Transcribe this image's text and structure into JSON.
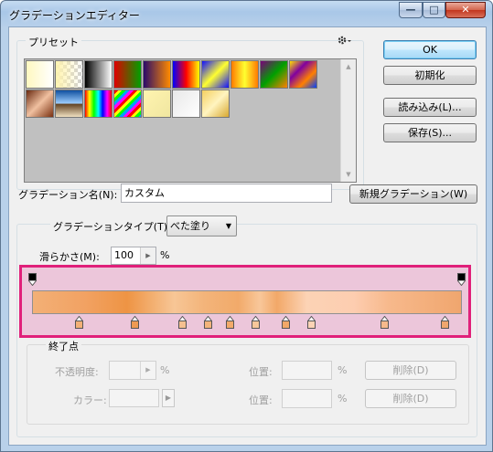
{
  "window": {
    "title": "グラデーションエディター"
  },
  "controls": {
    "minimize": "—",
    "maximize": "□",
    "close": "✕"
  },
  "presets": {
    "label": "プリセット",
    "menu_icon": "gear-icon",
    "swatches": [
      {
        "name": "foreground-to-background",
        "css": "linear-gradient(90deg,#fff8c0,#ffffff)"
      },
      {
        "name": "foreground-to-transparent",
        "css": "linear-gradient(90deg,#fff3b0,rgba(255,255,255,0))"
      },
      {
        "name": "black-white",
        "css": "linear-gradient(90deg,#000,#fff)"
      },
      {
        "name": "red-green",
        "css": "linear-gradient(90deg,#e00000,#00a000)"
      },
      {
        "name": "violet-orange",
        "css": "linear-gradient(90deg,#2a0a6a,#ff8a00)"
      },
      {
        "name": "blue-red-yellow",
        "css": "linear-gradient(90deg,#0000ff,#ff0000,#ffff00)"
      },
      {
        "name": "blue-yellow-blue",
        "css": "linear-gradient(135deg,#1010ff,#ffff30,#1010ff)"
      },
      {
        "name": "orange-yellow-orange",
        "css": "linear-gradient(90deg,#ff7a00,#ffff30,#ff7a00)"
      },
      {
        "name": "violet-green-orange",
        "css": "linear-gradient(135deg,#7a007a,#00a000,#ff8000)"
      },
      {
        "name": "yellow-violet-orange-blue",
        "css": "linear-gradient(135deg,#ffe000,#8000a0,#ff8000,#0040ff)"
      },
      {
        "name": "copper",
        "css": "linear-gradient(135deg,#6a2a10,#f0c0a0,#7a3010)"
      },
      {
        "name": "chrome",
        "css": "linear-gradient(180deg,#1050a0,#a0d0ff 50%,#604020 51%,#f0e0c0)"
      },
      {
        "name": "spectrum",
        "css": "linear-gradient(90deg,#ff0000,#ffff00,#00ff00,#00ffff,#0000ff,#ff00ff,#ff0000)"
      },
      {
        "name": "transparent-rainbow",
        "css": "repeating-linear-gradient(135deg,#ff0000 0 3px,#ffff00 3px 6px,#00ff00 6px 9px,#00a0ff 9px 12px,#ff00ff 12px 15px)"
      },
      {
        "name": "transparent-stripes",
        "css": "linear-gradient(135deg,#fff4b0,#f0e6a0)"
      },
      {
        "name": "transparent-checker",
        "css": "linear-gradient(135deg,#e8e8e8,#ffffff)"
      },
      {
        "name": "gold",
        "css": "linear-gradient(135deg,#f5d060,#fff4c0,#d8a830)"
      }
    ]
  },
  "buttons": {
    "ok": "OK",
    "reset": "初期化",
    "load": "読み込み(L)...",
    "save": "保存(S)...",
    "new_gradient": "新規グラデーション(W)"
  },
  "name_field": {
    "label": "グラデーション名(N):",
    "value": "カスタム"
  },
  "gradient_type": {
    "label": "グラデーションタイプ(T):",
    "value": "べた塗り"
  },
  "smoothness": {
    "label": "滑らかさ(M):",
    "value": "100",
    "unit": "%"
  },
  "gradient": {
    "css": "linear-gradient(90deg,#f3b076 0%,#f2a263 12%,#ee9444 22%,#f7c696 33%,#f3b47a 40%,#f2aa6a 48%,#f8c79a 53%,#f2a868 57%,#fcd3b5 64%,#fdcdb0 75%,#f7b98c 83%,#f0a66e 100%)",
    "opacity_stops": [
      0,
      100
    ],
    "color_stops": [
      {
        "pos": 11,
        "color": "#f3b076"
      },
      {
        "pos": 24,
        "color": "#ef9a52"
      },
      {
        "pos": 35,
        "color": "#f5c090"
      },
      {
        "pos": 41,
        "color": "#f3b47a"
      },
      {
        "pos": 46,
        "color": "#f2aa6a"
      },
      {
        "pos": 52,
        "color": "#f8c79a"
      },
      {
        "pos": 59,
        "color": "#f2a868"
      },
      {
        "pos": 65,
        "color": "#fcd3b5"
      },
      {
        "pos": 82,
        "color": "#f7b98c"
      },
      {
        "pos": 96,
        "color": "#f0a66e"
      }
    ]
  },
  "stops_group": {
    "label": "終了点",
    "opacity_label": "不透明度:",
    "percent": "%",
    "position_label": "位置:",
    "delete_label": "削除(D)",
    "color_label": "カラー:"
  }
}
